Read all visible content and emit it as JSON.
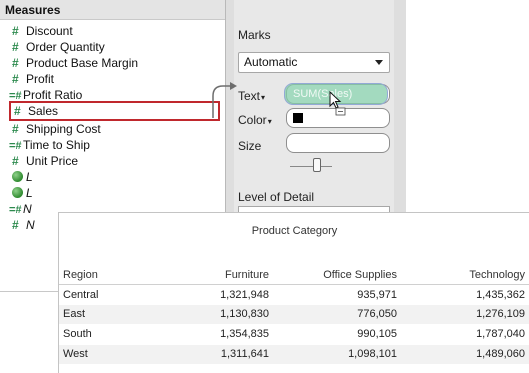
{
  "measures": {
    "header": "Measures",
    "fields": [
      {
        "label": "Discount",
        "type": "measure"
      },
      {
        "label": "Order Quantity",
        "type": "measure"
      },
      {
        "label": "Product Base Margin",
        "type": "measure"
      },
      {
        "label": "Profit",
        "type": "measure"
      },
      {
        "label": "Profit Ratio",
        "type": "calculated"
      },
      {
        "label": "Sales",
        "type": "measure",
        "selected": true
      },
      {
        "label": "Shipping Cost",
        "type": "measure"
      },
      {
        "label": "Time to Ship",
        "type": "calculated"
      },
      {
        "label": "Unit Price",
        "type": "measure"
      },
      {
        "label": "L",
        "type": "geo"
      },
      {
        "label": "L",
        "type": "geo"
      },
      {
        "label": "N",
        "type": "calculated"
      },
      {
        "label": "N",
        "type": "measure"
      }
    ],
    "hash_symbol": "#",
    "calc_symbol": "=#"
  },
  "marks": {
    "title": "Marks",
    "mark_type": "Automatic",
    "text_label": "Text",
    "color_label": "Color",
    "size_label": "Size",
    "level_of_detail_label": "Level of Detail",
    "dragged_pill": "SUM(Sales)",
    "caret": "▾"
  },
  "result_table": {
    "column_group": "Product Category",
    "row_header": "Region",
    "columns": [
      "Furniture",
      "Office Supplies",
      "Technology"
    ],
    "rows": [
      {
        "region": "Central",
        "values": [
          "1,321,948",
          "935,971",
          "1,435,362"
        ]
      },
      {
        "region": "East",
        "values": [
          "1,130,830",
          "776,050",
          "1,276,109"
        ]
      },
      {
        "region": "South",
        "values": [
          "1,354,835",
          "990,105",
          "1,787,040"
        ]
      },
      {
        "region": "West",
        "values": [
          "1,311,641",
          "1,098,101",
          "1,489,060"
        ]
      }
    ]
  },
  "colors": {
    "selection_border": "#c0282d",
    "measure_icon": "#2d8a4e",
    "drag_pill": "#84cdaa"
  }
}
